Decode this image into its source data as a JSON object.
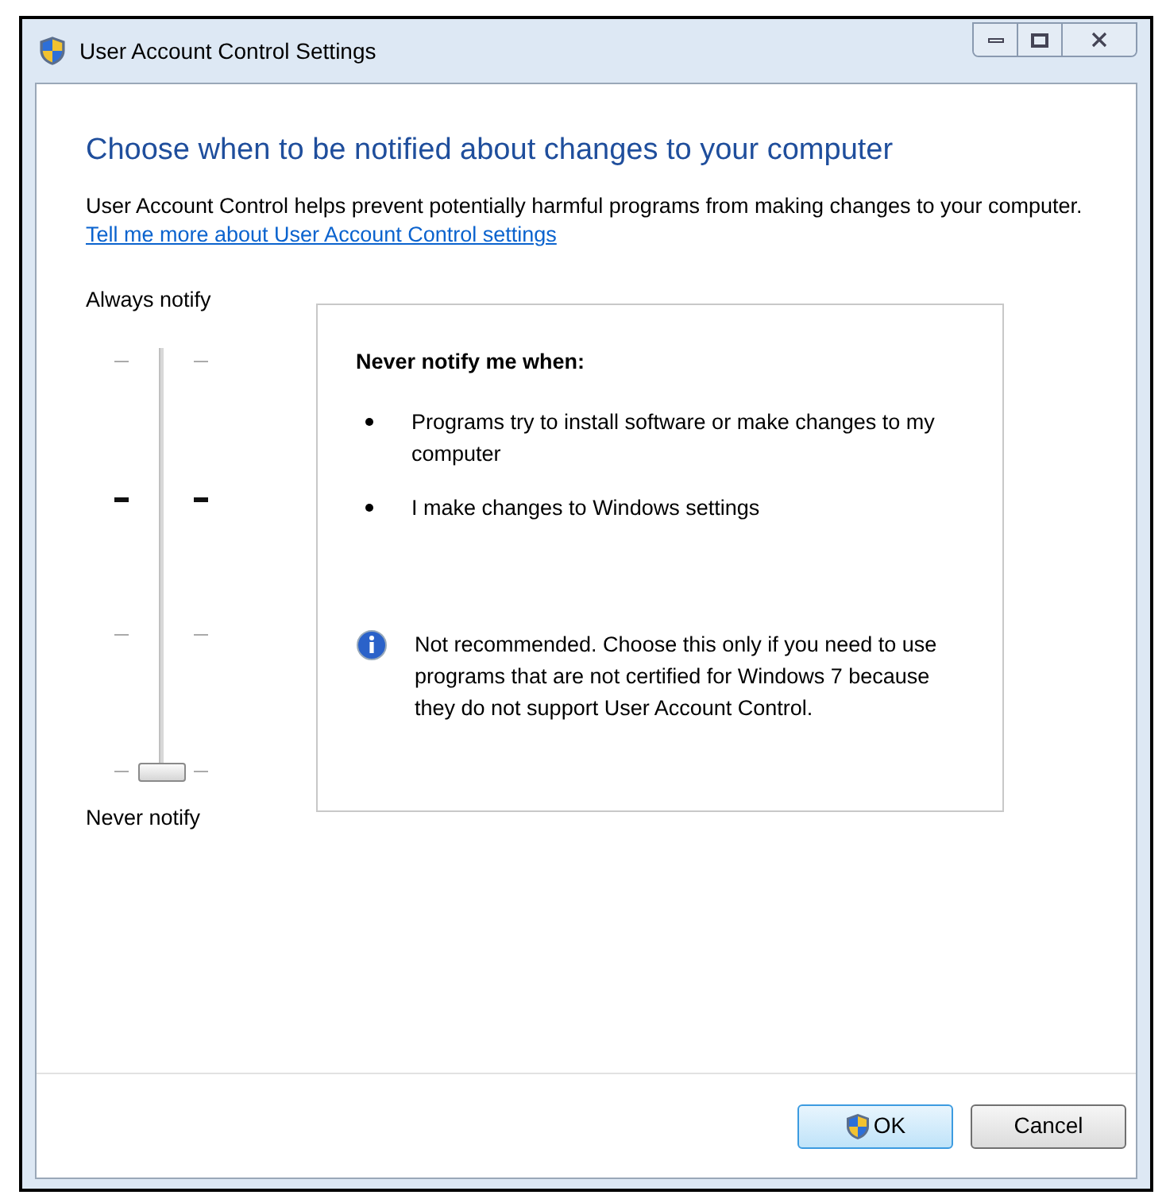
{
  "window": {
    "title": "User Account Control Settings"
  },
  "heading": "Choose when to be notified about changes to your computer",
  "description": "User Account Control helps prevent potentially harmful programs from making changes to your computer.",
  "link": "Tell me more about User Account Control settings",
  "slider": {
    "top_label": "Always notify",
    "bottom_label": "Never notify",
    "level": 0,
    "ticks": [
      {
        "emphasized": false
      },
      {
        "emphasized": true
      },
      {
        "emphasized": false
      },
      {
        "emphasized": false
      }
    ]
  },
  "info": {
    "title": "Never notify me when:",
    "bullets": [
      "Programs try to install software or make changes to my computer",
      "I make changes to Windows settings"
    ],
    "note": "Not recommended. Choose this only if you need to use programs that are not certified for Windows 7 because they do not support User Account Control."
  },
  "buttons": [
    {
      "label": "OK",
      "kind": "default"
    },
    {
      "label": "Cancel",
      "kind": "normal"
    }
  ]
}
